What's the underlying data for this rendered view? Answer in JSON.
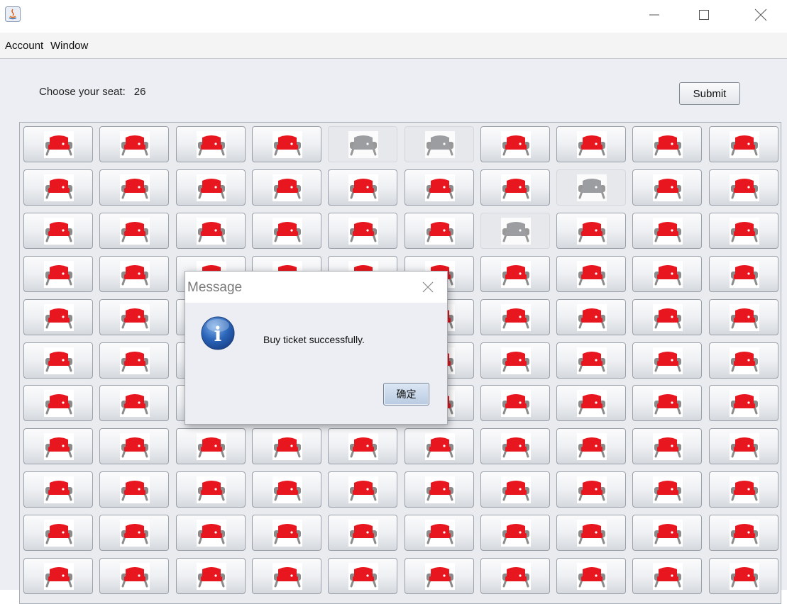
{
  "menu": [
    "Account",
    "Window"
  ],
  "header": {
    "prompt": "Choose your seat:",
    "seat_number": "26",
    "submit_label": "Submit"
  },
  "seats": {
    "rows": 11,
    "cols": 10,
    "taken": [
      [
        0,
        4
      ],
      [
        0,
        5
      ],
      [
        1,
        7
      ],
      [
        2,
        6
      ]
    ],
    "available_color": "#e8161e",
    "taken_color": "#8f9093",
    "icon": "sofa-icon"
  },
  "dialog": {
    "title": "Message",
    "message": "Buy ticket successfully.",
    "ok_label": "确定",
    "icon": "info-icon"
  }
}
